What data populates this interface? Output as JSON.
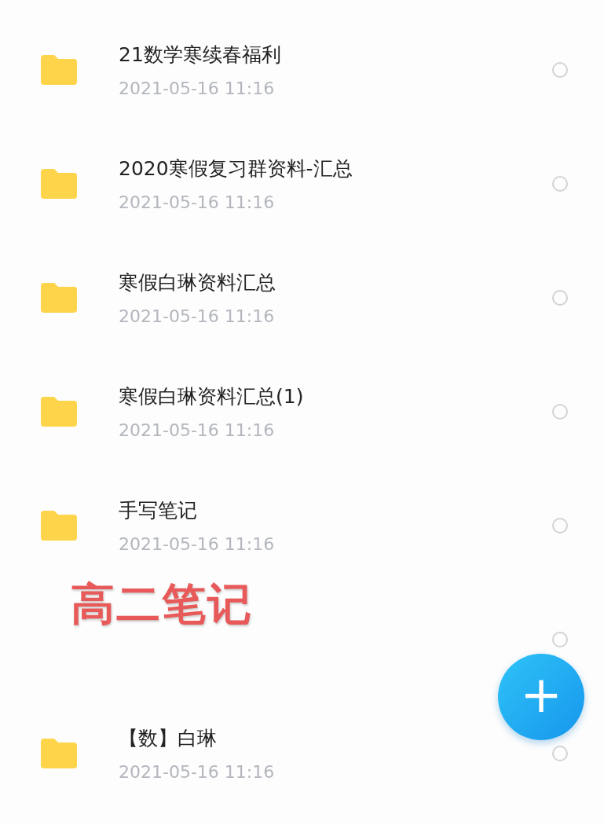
{
  "files": [
    {
      "kind": "folder",
      "name": "21数学寒续春福利",
      "date": "2021-05-16  11:16",
      "selected": false
    },
    {
      "kind": "folder",
      "name": "2020寒假复习群资料-汇总",
      "date": "2021-05-16  11:16",
      "selected": false
    },
    {
      "kind": "folder",
      "name": "寒假白琳资料汇总",
      "date": "2021-05-16  11:16",
      "selected": false
    },
    {
      "kind": "folder",
      "name": "寒假白琳资料汇总(1)",
      "date": "2021-05-16  11:16",
      "selected": false
    },
    {
      "kind": "folder",
      "name": "手写笔记",
      "date": "2021-05-16  11:16",
      "selected": false
    },
    {
      "kind": "covered",
      "selected": false
    },
    {
      "kind": "folder",
      "name": "【数】白琳",
      "date": "2021-05-16  11:16",
      "selected": false
    }
  ],
  "annotation": {
    "text": "高二笔记"
  },
  "fab": {
    "label": "+"
  }
}
